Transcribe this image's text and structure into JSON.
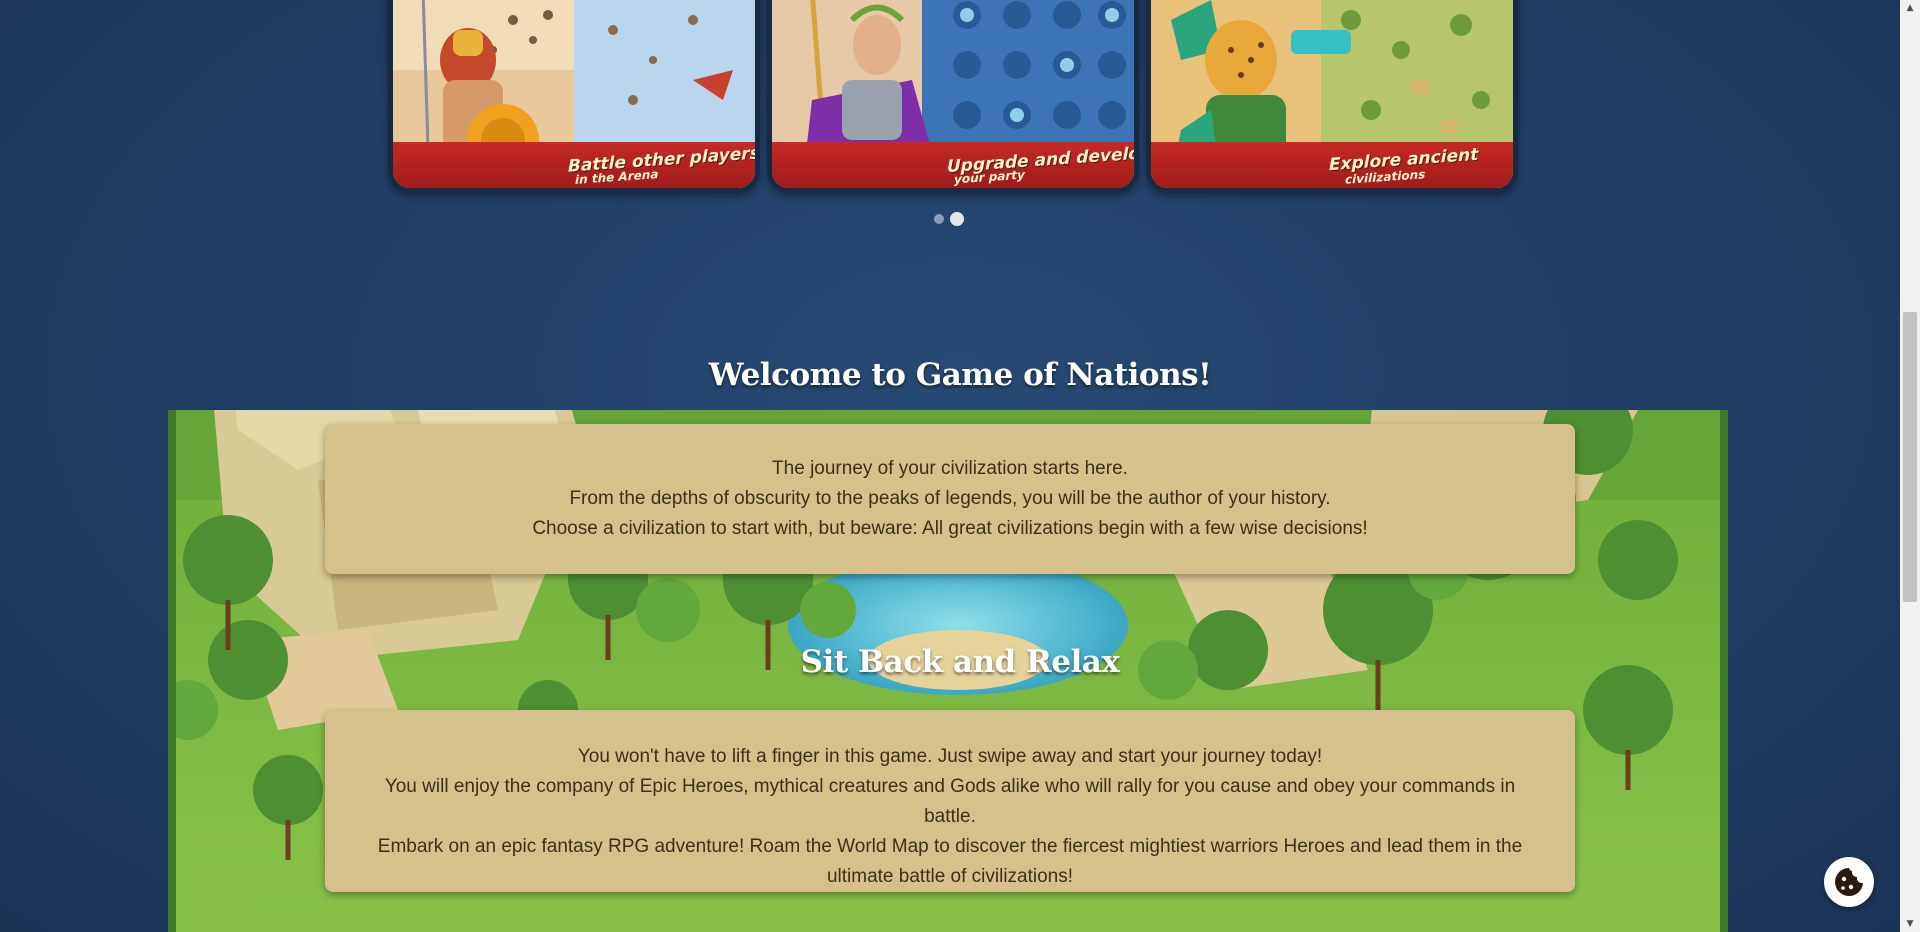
{
  "carousel": {
    "cards": [
      {
        "title": "Battle other players",
        "subtitle": "in the Arena"
      },
      {
        "title": "Upgrade and develop",
        "subtitle": "your party"
      },
      {
        "title": "Explore ancient",
        "subtitle": "civilizations"
      }
    ],
    "dots": 2,
    "active_dot": 2
  },
  "welcome": {
    "title": "Welcome to Game of Nations!",
    "lines": [
      "The journey of your civilization starts here.",
      "From the depths of obscurity to the peaks of legends, you will be the author of your history.",
      "Choose a civilization to start with, but beware: All great civilizations begin with a few wise decisions!"
    ]
  },
  "relax": {
    "title": "Sit Back and Relax",
    "lines": [
      "You won't have to lift a finger in this game. Just swipe away and start your journey today!",
      "You will enjoy the company of Epic Heroes, mythical creatures and Gods alike who will rally for you cause and obey your commands in battle.",
      "Embark on an epic fantasy RPG adventure! Roam the World Map to discover the fiercest mightiest warriors Heroes and lead them in the ultimate battle of civilizations!"
    ]
  },
  "cookie": {
    "icon": "cookie-icon"
  },
  "colors": {
    "background": "#1f3d63",
    "panel": "#d6c18d",
    "banner": "#c62a25",
    "grass": "#79b53c"
  }
}
